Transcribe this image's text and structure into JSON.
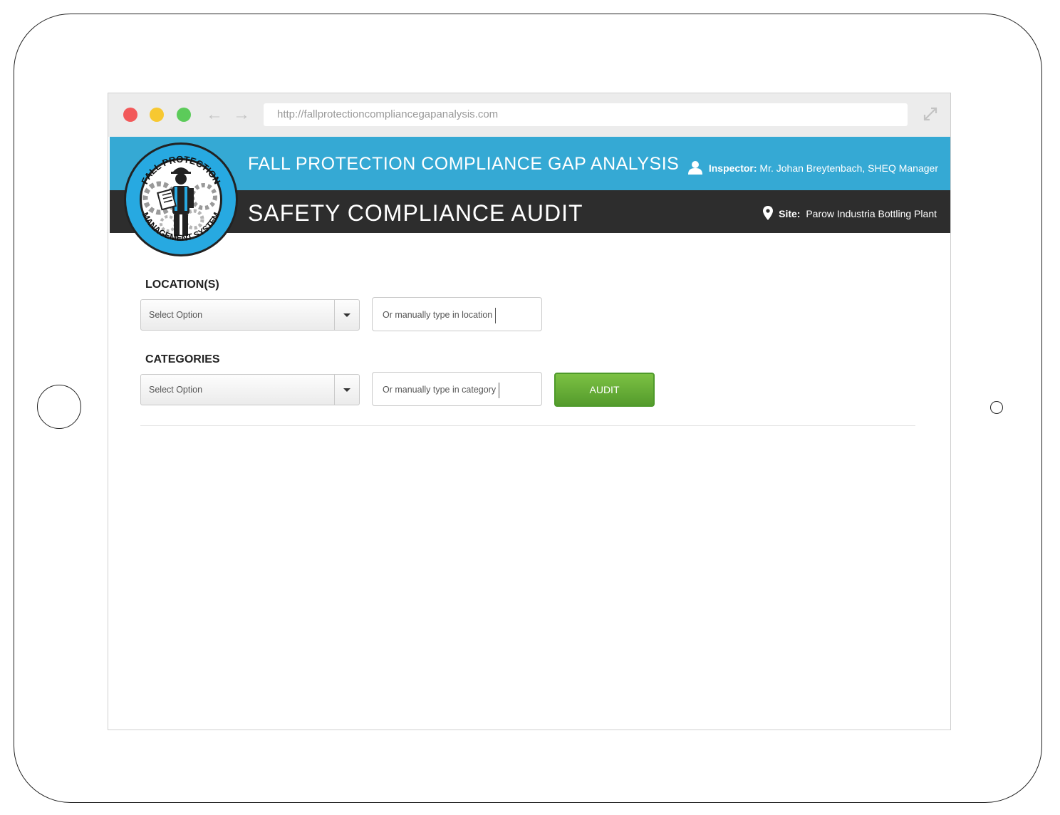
{
  "browser": {
    "url": "http://fallprotectioncompliancegapanalysis.com"
  },
  "logo": {
    "top_text": "FALL PROTECTION",
    "bottom_text": "MANAGEMENT SYSTEM"
  },
  "header": {
    "app_title": "FALL PROTECTION COMPLIANCE GAP ANALYSIS",
    "page_title": "SAFETY COMPLIANCE AUDIT",
    "inspector_label": "Inspector:",
    "inspector_value": "Mr. Johan Breytenbach, SHEQ Manager",
    "site_label": "Site:",
    "site_value": "Parow Industria Bottling Plant"
  },
  "form": {
    "location": {
      "label": "LOCATION(S)",
      "select_value": "Select Option",
      "input_text": "Or manually type in location"
    },
    "category": {
      "label": "CATEGORIES",
      "select_value": "Select Option",
      "input_text": "Or manually type in category"
    },
    "audit_label": "AUDIT"
  },
  "colors": {
    "header_blue": "#35a9d4",
    "header_dark": "#2d2d2d",
    "audit_green": "#6aaf38"
  },
  "icons": {
    "inspector": "user-icon",
    "site": "map-pin-icon",
    "back": "arrow-left-icon",
    "forward": "arrow-right-icon",
    "expand": "expand-icon"
  }
}
